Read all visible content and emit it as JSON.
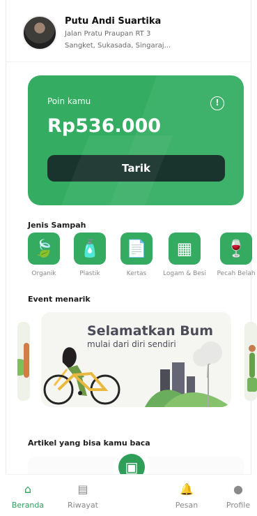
{
  "profile": {
    "name": "Putu Andi Suartika",
    "address_line_1": "Jalan Pratu Praupan RT 3",
    "address_line_2": "Sangket, Sukasada, Singaraj..."
  },
  "wallet": {
    "points_label": "Poin kamu",
    "points_value": "Rp536.000",
    "withdraw_label": "Tarik",
    "info_icon": "info-icon",
    "accent": "#34AD63"
  },
  "waste_types": {
    "title": "Jenis Sampah",
    "items": [
      {
        "label": "Organik",
        "icon": "leaf-icon"
      },
      {
        "label": "Plastik",
        "icon": "plastic-bottle-icon"
      },
      {
        "label": "Kertas",
        "icon": "paper-icon"
      },
      {
        "label": "Logam & Besi",
        "icon": "metal-icon"
      },
      {
        "label": "Pecah Belah",
        "icon": "glass-icon"
      }
    ]
  },
  "events": {
    "title": "Event menarik",
    "card_heading": "Selamatkan Bum",
    "card_subtitle": "mulai dari diri sendiri"
  },
  "articles": {
    "title": "Artikel yang bisa kamu baca"
  },
  "navigation": {
    "items": [
      {
        "label": "Beranda",
        "icon": "home-icon",
        "active": true
      },
      {
        "label": "Riwayat",
        "icon": "history-icon",
        "active": false
      },
      {
        "label": "Pesan",
        "icon": "bell-icon",
        "active": false
      },
      {
        "label": "Profile",
        "icon": "profile-icon",
        "active": false
      }
    ],
    "center_icon": "wallet-icon"
  },
  "colors": {
    "primary": "#2F9E59",
    "dark_button": "#19342D",
    "muted_text": "#8A8A8A"
  }
}
